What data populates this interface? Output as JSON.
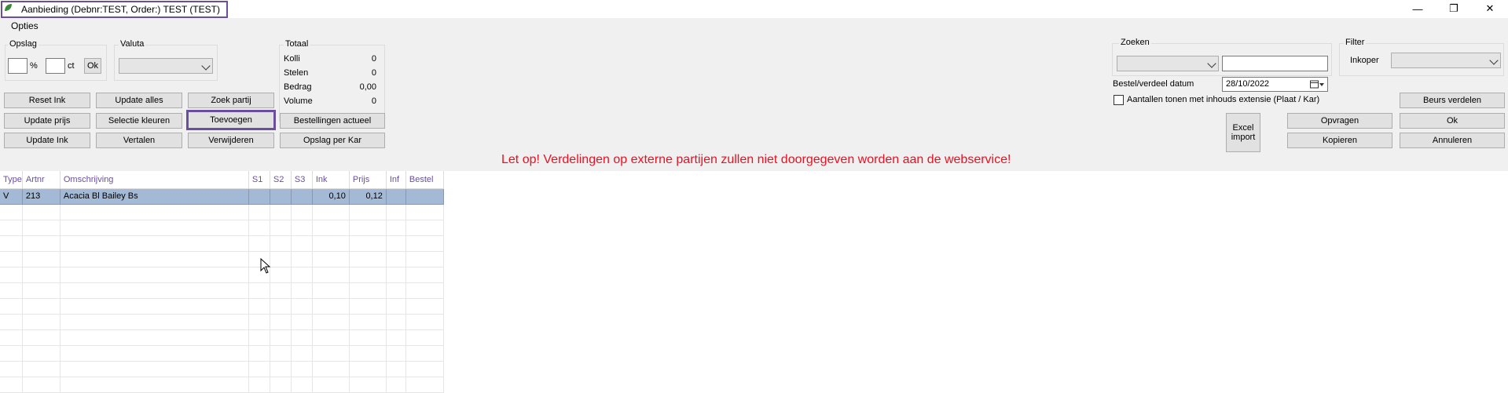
{
  "window": {
    "title": "Aanbieding (Debnr:TEST, Order:) TEST (TEST)",
    "controls": {
      "minimize": "—",
      "maximize": "❐",
      "close": "✕"
    }
  },
  "menu": {
    "opties": "Opties"
  },
  "opslag": {
    "label": "Opslag",
    "percent_unit": "%",
    "ct_unit": "ct",
    "ok": "Ok"
  },
  "valuta": {
    "label": "Valuta",
    "value": ""
  },
  "totaal": {
    "label": "Totaal",
    "rows": [
      {
        "label": "Kolli",
        "value": "0"
      },
      {
        "label": "Stelen",
        "value": "0"
      },
      {
        "label": "Bedrag",
        "value": "0,00"
      },
      {
        "label": "Volume",
        "value": "0"
      }
    ]
  },
  "buttons": {
    "reset_ink": "Reset Ink",
    "update_alles": "Update alles",
    "zoek_partij": "Zoek partij",
    "update_prijs": "Update prijs",
    "selectie_kleuren": "Selectie kleuren",
    "toevoegen": "Toevoegen",
    "bestellingen_actueel": "Bestellingen actueel",
    "update_ink": "Update Ink",
    "vertalen": "Vertalen",
    "verwijderen": "Verwijderen",
    "opslag_per_kar": "Opslag per Kar",
    "excel_import": "Excel import",
    "opvragen": "Opvragen",
    "kopieren": "Kopieren",
    "beurs_verdelen": "Beurs verdelen",
    "ok": "Ok",
    "annuleren": "Annuleren"
  },
  "zoeken": {
    "label": "Zoeken",
    "value": ""
  },
  "datum": {
    "label": "Bestel/verdeel datum",
    "value": "28/10/2022"
  },
  "aantallen": {
    "label": "Aantallen tonen met inhouds extensie (Plaat / Kar)",
    "checked": false
  },
  "filter": {
    "label": "Filter",
    "inkoper_label": "Inkoper",
    "inkoper_value": ""
  },
  "warning": "Let op! Verdelingen op externe partijen zullen niet doorgegeven worden aan de webservice!",
  "grid": {
    "columns": [
      "Type",
      "Artnr",
      "Omschrijving",
      "S1",
      "S2",
      "S3",
      "Ink",
      "Prijs",
      "Inf",
      "Bestel"
    ],
    "rows": [
      [
        "V",
        "213",
        "Acacia Bl Bailey Bs",
        "",
        "",
        "",
        "0,10",
        "0,12",
        "",
        ""
      ]
    ],
    "empty_rows": 12
  },
  "colors": {
    "accent": "#6a4fa0",
    "selected_row": "#a3b9d5",
    "bestel_cell": "#ffff00",
    "warning": "#e81123"
  }
}
